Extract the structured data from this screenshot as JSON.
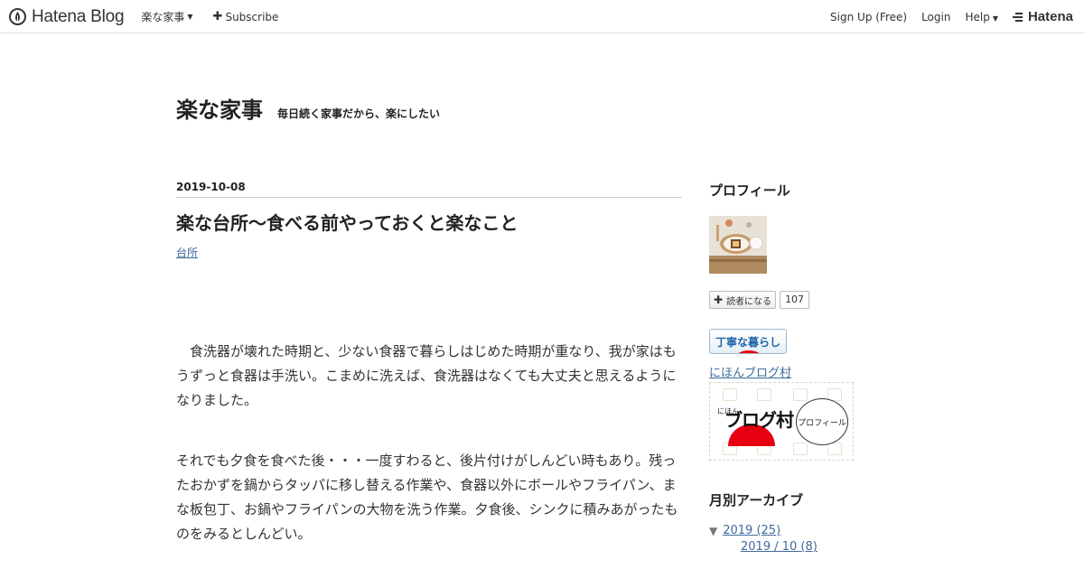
{
  "header": {
    "brand_name": "Hatena Blog",
    "blog_menu_label": "楽な家事",
    "subscribe_label": "Subscribe",
    "signup_label": "Sign Up (Free)",
    "login_label": "Login",
    "help_label": "Help",
    "hatena_label": "Hatena"
  },
  "blog": {
    "title": "楽な家事",
    "description": "毎日続く家事だから、楽にしたい"
  },
  "entry": {
    "date": "2019-10-08",
    "title": "楽な台所～食べる前やっておくと楽なこと",
    "category": "台所",
    "paragraphs": [
      "　食洗器が壊れた時期と、少ない食器で暮らしはじめた時期が重なり、我が家はもうずっと食器は手洗い。こまめに洗えば、食洗器はなくても大丈夫と思えるようになりました。",
      "それでも夕食を食べた後・・・一度すわると、後片付けがしんどい時もあり。残ったおかずを鍋からタッパに移し替える作業や、食器以外にボールやフライパン、まな板包丁、お鍋やフライパンの大物を洗う作業。夕食後、シンクに積みあがったものをみるとしんどい。"
    ]
  },
  "sidebar": {
    "profile_heading": "プロフィール",
    "reader_button_label": "読者になる",
    "reader_count": "107",
    "teinei_label": "丁寧な暮らし",
    "nihon_link": "にほんブログ村",
    "banner_small": "にほん",
    "banner_big": "ブログ村",
    "banner_bubble": "プロフィール",
    "archive_heading": "月別アーカイブ",
    "archive_year": "2019 (25)",
    "archive_month": "2019 / 10 (8)"
  },
  "colors": {
    "link": "#3f6a9b",
    "text": "#222222",
    "nihon_red": "#e60012"
  }
}
